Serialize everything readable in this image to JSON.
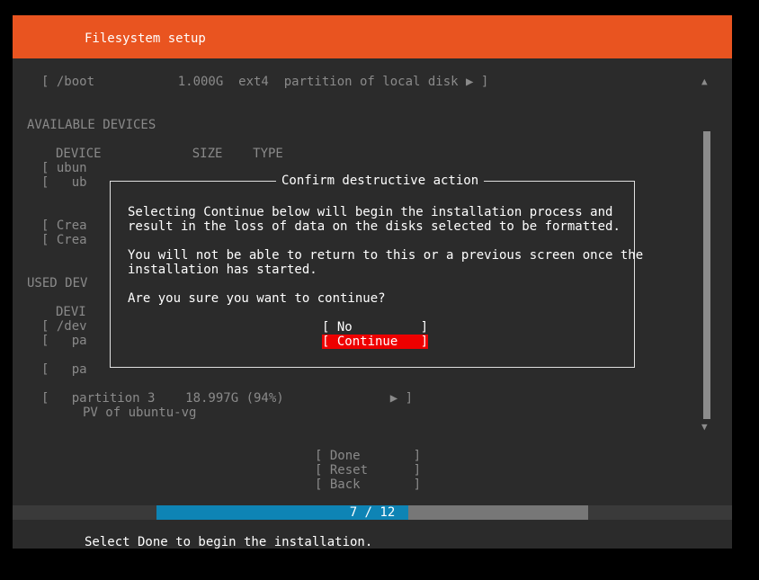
{
  "header": {
    "title": "Filesystem setup"
  },
  "background": {
    "boot_row": "[ /boot           1.000G  ext4  partition of local disk ▶ ]",
    "available_devices": {
      "heading": "AVAILABLE DEVICES",
      "columns": "DEVICE            SIZE    TYPE",
      "rows": [
        "[ ubun",
        "[   ub",
        "[ Crea",
        "[ Crea"
      ]
    },
    "used_devices": {
      "heading": "USED DEV",
      "columns": "DEVI",
      "rows": [
        "[ /dev",
        "[   pa",
        "[   pa"
      ],
      "partition_row": "[   partition 3    18.997G (94%)              ▶ ]",
      "partition_sub": "PV of ubuntu-vg"
    },
    "buttons": [
      "[ Done       ]",
      "[ Reset      ]",
      "[ Back       ]"
    ]
  },
  "dialog": {
    "title": "Confirm destructive action",
    "lines": [
      "Selecting Continue below will begin the installation process and",
      "result in the loss of data on the disks selected to be formatted.",
      "You will not be able to return to this or a previous screen once the",
      "installation has started.",
      "Are you sure you want to continue?"
    ],
    "no_button": "[ No         ]",
    "continue_button": "[ Continue   ]"
  },
  "progress": {
    "text": "7 / 12",
    "current": 7,
    "total": 12
  },
  "footer": {
    "text": "Select Done to begin the installation."
  },
  "colors": {
    "header": "#e95420",
    "panel": "#2b2b2b",
    "selected_button": "#ee0000",
    "progress_fill": "#0e84b5",
    "progress_track": "#777777"
  }
}
